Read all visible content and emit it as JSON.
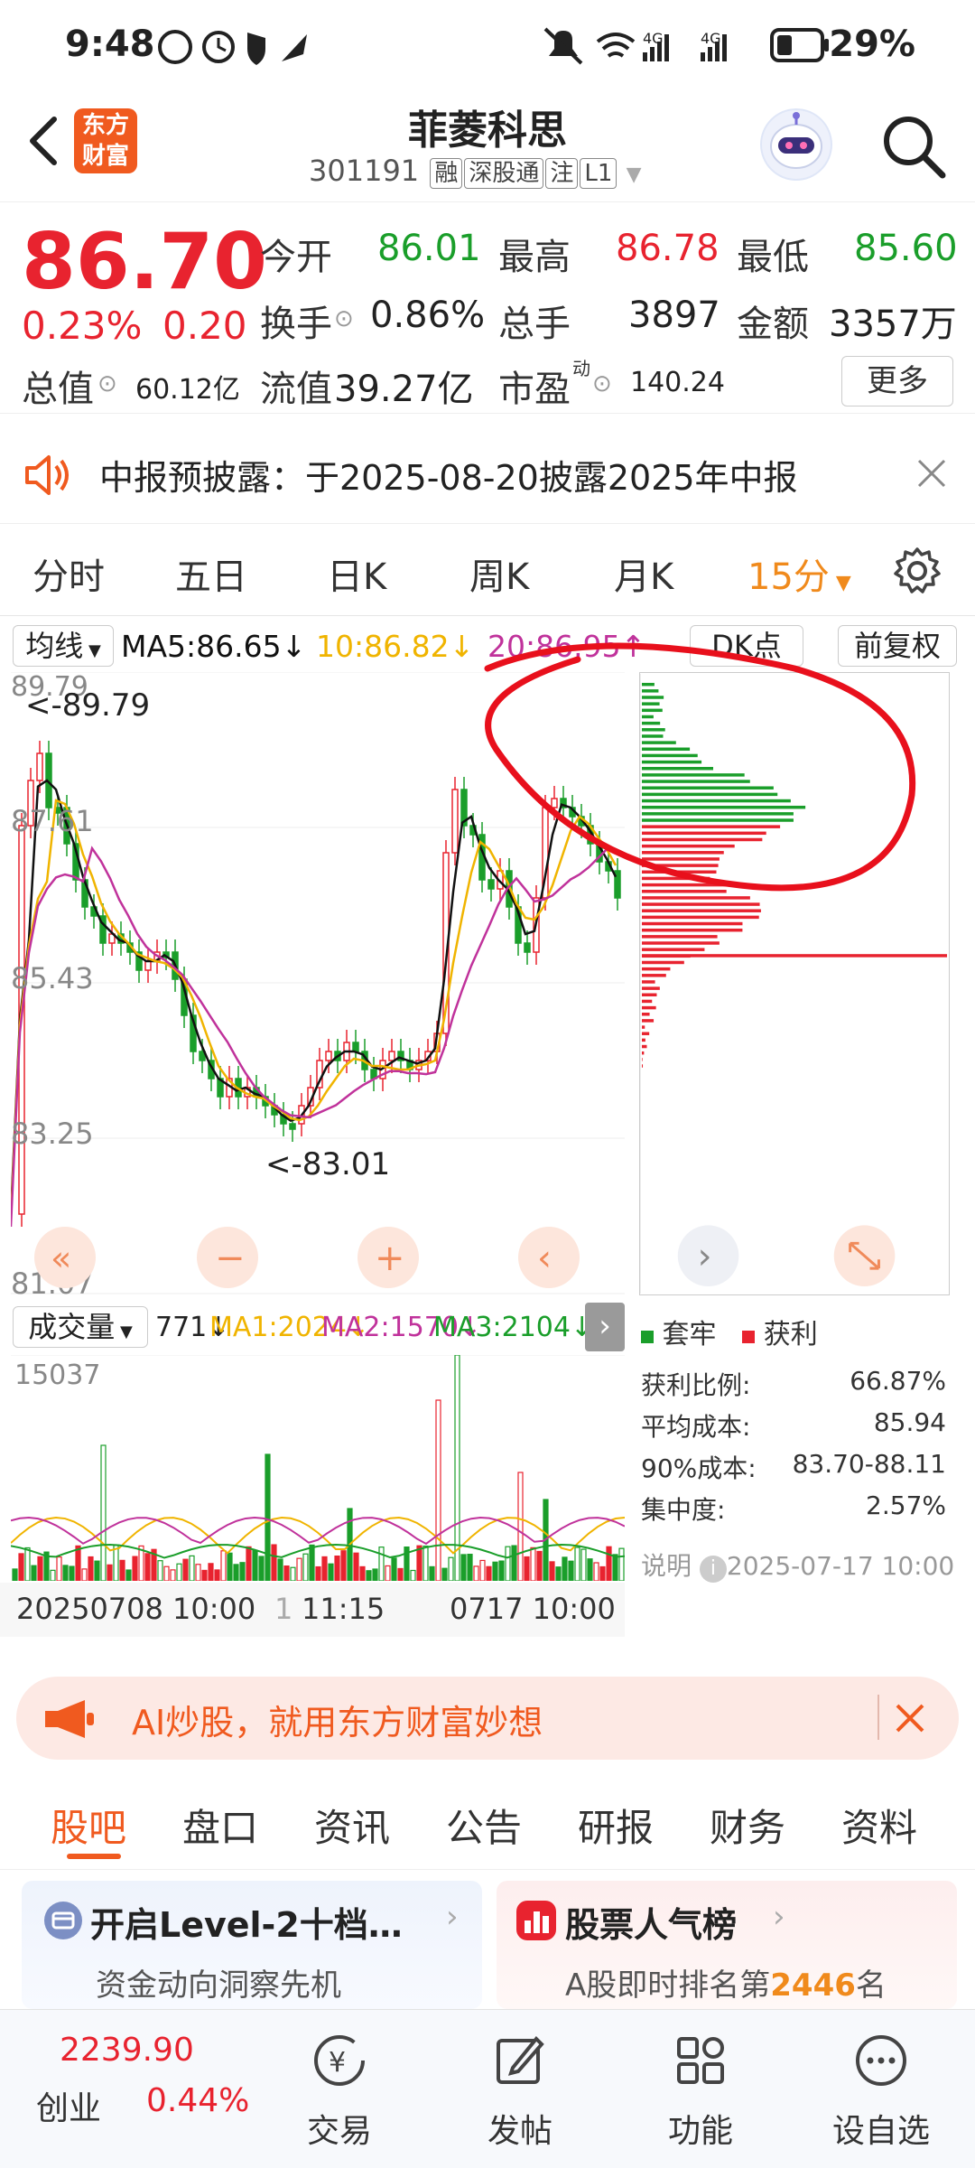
{
  "status_bar": {
    "time": "9:48",
    "battery": "29%",
    "net1": "4G",
    "net2": "4G"
  },
  "header": {
    "logo_line1": "东方",
    "logo_line2": "财富",
    "stock_name": "菲菱科思",
    "stock_code": "301191",
    "tags": [
      "融",
      "深股通",
      "注",
      "L1"
    ]
  },
  "quote": {
    "price": "86.70",
    "change_pct": "0.23%",
    "change_abs": "0.20",
    "open_label": "今开",
    "open": "86.01",
    "high_label": "最高",
    "high": "86.78",
    "low_label": "最低",
    "low": "85.60",
    "turnover_label": "换手",
    "turnover": "0.86%",
    "volume_label": "总手",
    "volume": "3897",
    "amount_label": "金额",
    "amount": "3357万",
    "mktcap_label": "总值",
    "mktcap": "60.12亿",
    "float_label": "流值",
    "float_cap": "39.27亿",
    "pe_label": "市盈",
    "pe_sup": "动",
    "pe": "140.24",
    "more": "更多"
  },
  "notice": {
    "text": "中报预披露：于2025-08-20披露2025年中报"
  },
  "period_tabs": [
    "分时",
    "五日",
    "日K",
    "周K",
    "月K",
    "15分"
  ],
  "ma_line": {
    "selector": "均线",
    "ma5": "MA5:86.65↓",
    "ma10": "10:86.82↓",
    "ma20": "20:86.95↑",
    "dk": "DK点",
    "adjust": "前复权"
  },
  "kchart": {
    "y_ticks": [
      "89.79",
      "87.61",
      "85.43",
      "83.25",
      "81.07"
    ],
    "high_marker": "<-89.79",
    "low_marker": "<-83.01",
    "colors": {
      "up": "#e8232f",
      "down": "#1a9e2a",
      "ma5": "#111111",
      "ma10": "#f0b400",
      "ma20": "#c0329b"
    }
  },
  "chip_profile": {
    "legend_trapped": "套牢",
    "legend_profit": "获利",
    "rows": [
      {
        "label": "获利比例:",
        "value": "66.87%"
      },
      {
        "label": "平均成本:",
        "value": "85.94"
      },
      {
        "label": "90%成本:",
        "value": "83.70-88.11"
      },
      {
        "label": "集中度:",
        "value": "2.57%"
      }
    ],
    "note_label": "说明",
    "note_time": "2025-07-17 10:00"
  },
  "volume": {
    "selector": "成交量",
    "vol": "771↓",
    "ma1": "MA1:2024↓",
    "ma2": "MA2:1570↓",
    "ma3": "MA3:2104↓",
    "max_label": "15037",
    "x_labels": [
      "20250708 10:00",
      "1",
      "11:15",
      "0717 10:00"
    ]
  },
  "ai_banner": {
    "text": "AI炒股，就用东方财富妙想"
  },
  "bottom_tabs": [
    "股吧",
    "盘口",
    "资讯",
    "公告",
    "研报",
    "财务",
    "资料"
  ],
  "cards": [
    {
      "title": "开启Level-2十档…",
      "sub": "资金动向洞察先机"
    },
    {
      "title": "股票人气榜",
      "sub_prefix": "A股即时排名第",
      "sub_num": "2446",
      "sub_suffix": "名"
    }
  ],
  "bottom_nav": {
    "index_value": "2239.90",
    "index_name": "创业",
    "index_change": "0.44%",
    "items": [
      "交易",
      "发帖",
      "功能",
      "设自选"
    ]
  }
}
